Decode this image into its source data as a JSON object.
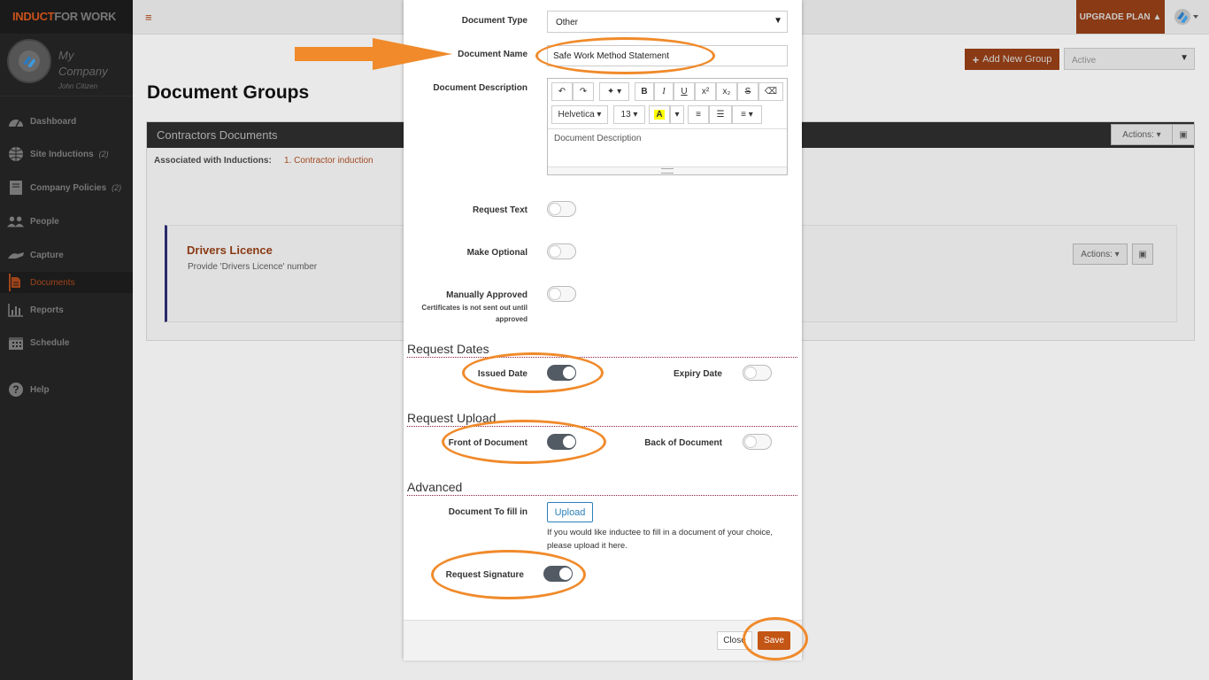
{
  "app": {
    "logo_a": "INDUCT",
    "logo_b": "FOR WORK",
    "company": "My Company",
    "user": "John Citizen",
    "upgrade": "UPGRADE PLAN"
  },
  "nav": [
    {
      "label": "Dashboard",
      "icon": "dashboard-icon"
    },
    {
      "label": "Site Inductions",
      "count": "(2)",
      "icon": "globe-icon"
    },
    {
      "label": "Company Policies",
      "count": "(2)",
      "icon": "book-icon"
    },
    {
      "label": "People",
      "icon": "people-icon"
    },
    {
      "label": "Capture",
      "icon": "hand-icon"
    },
    {
      "label": "Documents",
      "icon": "document-icon"
    },
    {
      "label": "Reports",
      "icon": "bar-chart-icon"
    },
    {
      "label": "Schedule",
      "icon": "calendar-icon"
    },
    {
      "label": "Help",
      "icon": "help-icon"
    }
  ],
  "main": {
    "title": "Document Groups",
    "add_group": "Add New Group",
    "status": "Active",
    "panel_title": "Contractors Documents",
    "actions": "Actions:",
    "assoc_label": "Associated with Inductions:",
    "assoc_link": "1. Contractor induction",
    "card_title": "Drivers Licence",
    "card_desc": "Provide 'Drivers Licence' number"
  },
  "modal": {
    "doc_type_label": "Document Type",
    "doc_type_value": "Other",
    "doc_name_label": "Document Name",
    "doc_name_value": "Safe Work Method Statement",
    "doc_desc_label": "Document Description",
    "doc_desc_placeholder": "Document Description",
    "font_name": "Helvetica",
    "font_size": "13",
    "request_text": "Request Text",
    "make_optional": "Make Optional",
    "manually_approved": "Manually Approved",
    "manual_note_1": "Certificates is not sent out until",
    "manual_note_2": "approved",
    "section_dates": "Request Dates",
    "issued_date": "Issued Date",
    "expiry_date": "Expiry Date",
    "section_upload": "Request Upload",
    "front_doc": "Front of Document",
    "back_doc": "Back of Document",
    "section_advanced": "Advanced",
    "doc_fill_label": "Document To fill in",
    "upload_btn": "Upload",
    "upload_help": "If you would like inductee to fill in a document of your choice, please upload it here.",
    "request_signature": "Request Signature",
    "close_btn": "Close",
    "save_btn": "Save"
  },
  "toggles": {
    "request_text": false,
    "make_optional": false,
    "manually_approved": false,
    "issued_date": true,
    "expiry_date": false,
    "front_doc": true,
    "back_doc": false,
    "request_signature": true
  },
  "colors": {
    "accent": "#c35515",
    "annotation": "#f08a2a",
    "toggle_on": "#525a63",
    "section_rule": "#8a1f3c"
  }
}
